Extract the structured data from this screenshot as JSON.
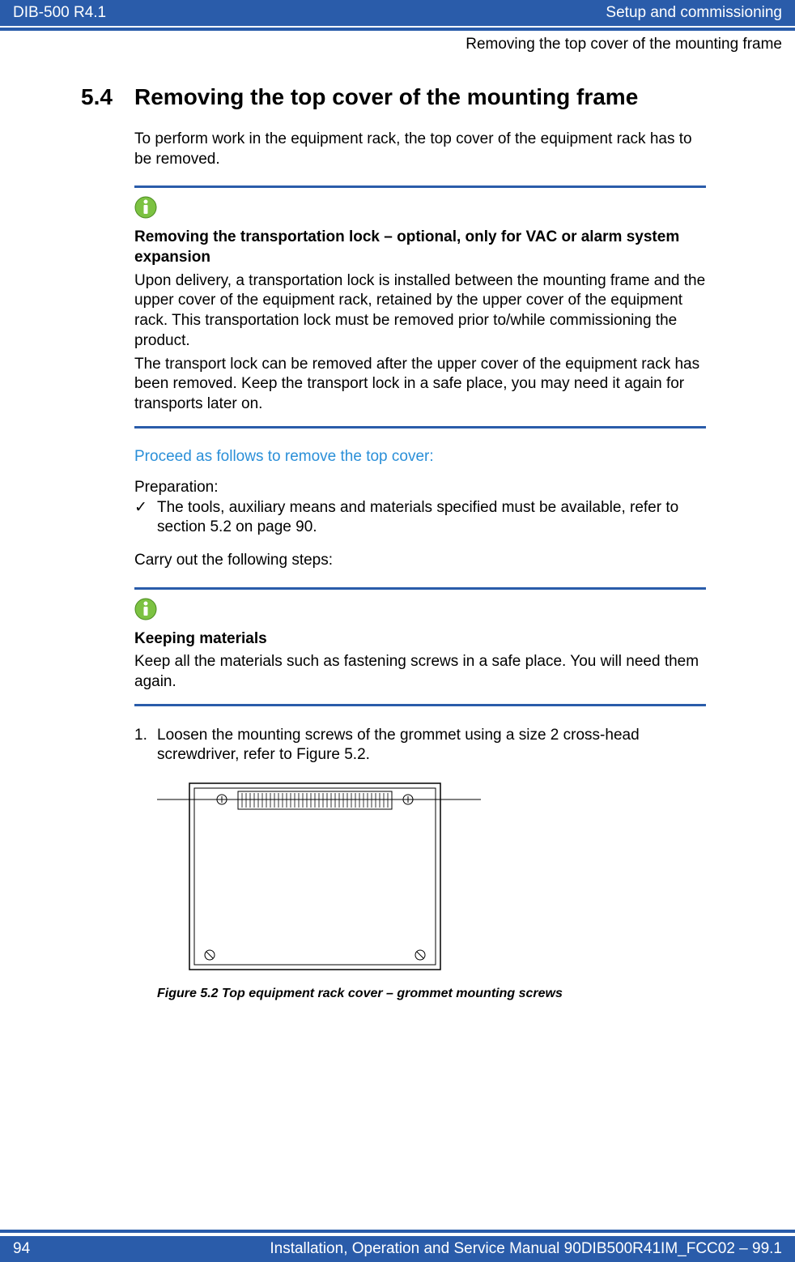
{
  "header": {
    "left": "DIB-500 R4.1",
    "right": "Setup and commissioning"
  },
  "sub_header": "Removing the top cover of the mounting frame",
  "section": {
    "number": "5.4",
    "title": "Removing the top cover of the mounting frame"
  },
  "intro": "To perform work in the equipment rack, the top cover of the equipment rack has to be removed.",
  "note1": {
    "heading": "Removing the transportation lock – optional, only for VAC or alarm system expansion",
    "p1": "Upon delivery, a transportation lock is installed between the mounting frame and the upper cover of the equipment rack, retained by the upper cover of the equipment rack. This transportation lock must be removed prior to/while commissioning the product.",
    "p2": "The transport lock can be removed after the upper cover of the equipment rack has been removed. Keep the transport lock in a safe place, you may need it again for transports later on."
  },
  "blue_heading": "Proceed as follows to remove the top cover:",
  "prep_label": "Preparation:",
  "prep_item": "The tools, auxiliary means and materials specified must be available, refer to section 5.2 on page 90.",
  "carry_out": "Carry out the following steps:",
  "note2": {
    "heading": "Keeping materials",
    "p1": "Keep all the materials such as fastening screws in a safe place. You will need them again."
  },
  "step1": {
    "num": "1.",
    "text": "Loosen the mounting screws of the grommet using a size 2 cross-head screwdriver, refer to Figure 5.2."
  },
  "figure_caption": "Figure 5.2 Top equipment rack cover – grommet mounting screws",
  "footer": {
    "left": "94",
    "right": "Installation, Operation and Service Manual 90DIB500R41IM_FCC02  –  99.1"
  }
}
